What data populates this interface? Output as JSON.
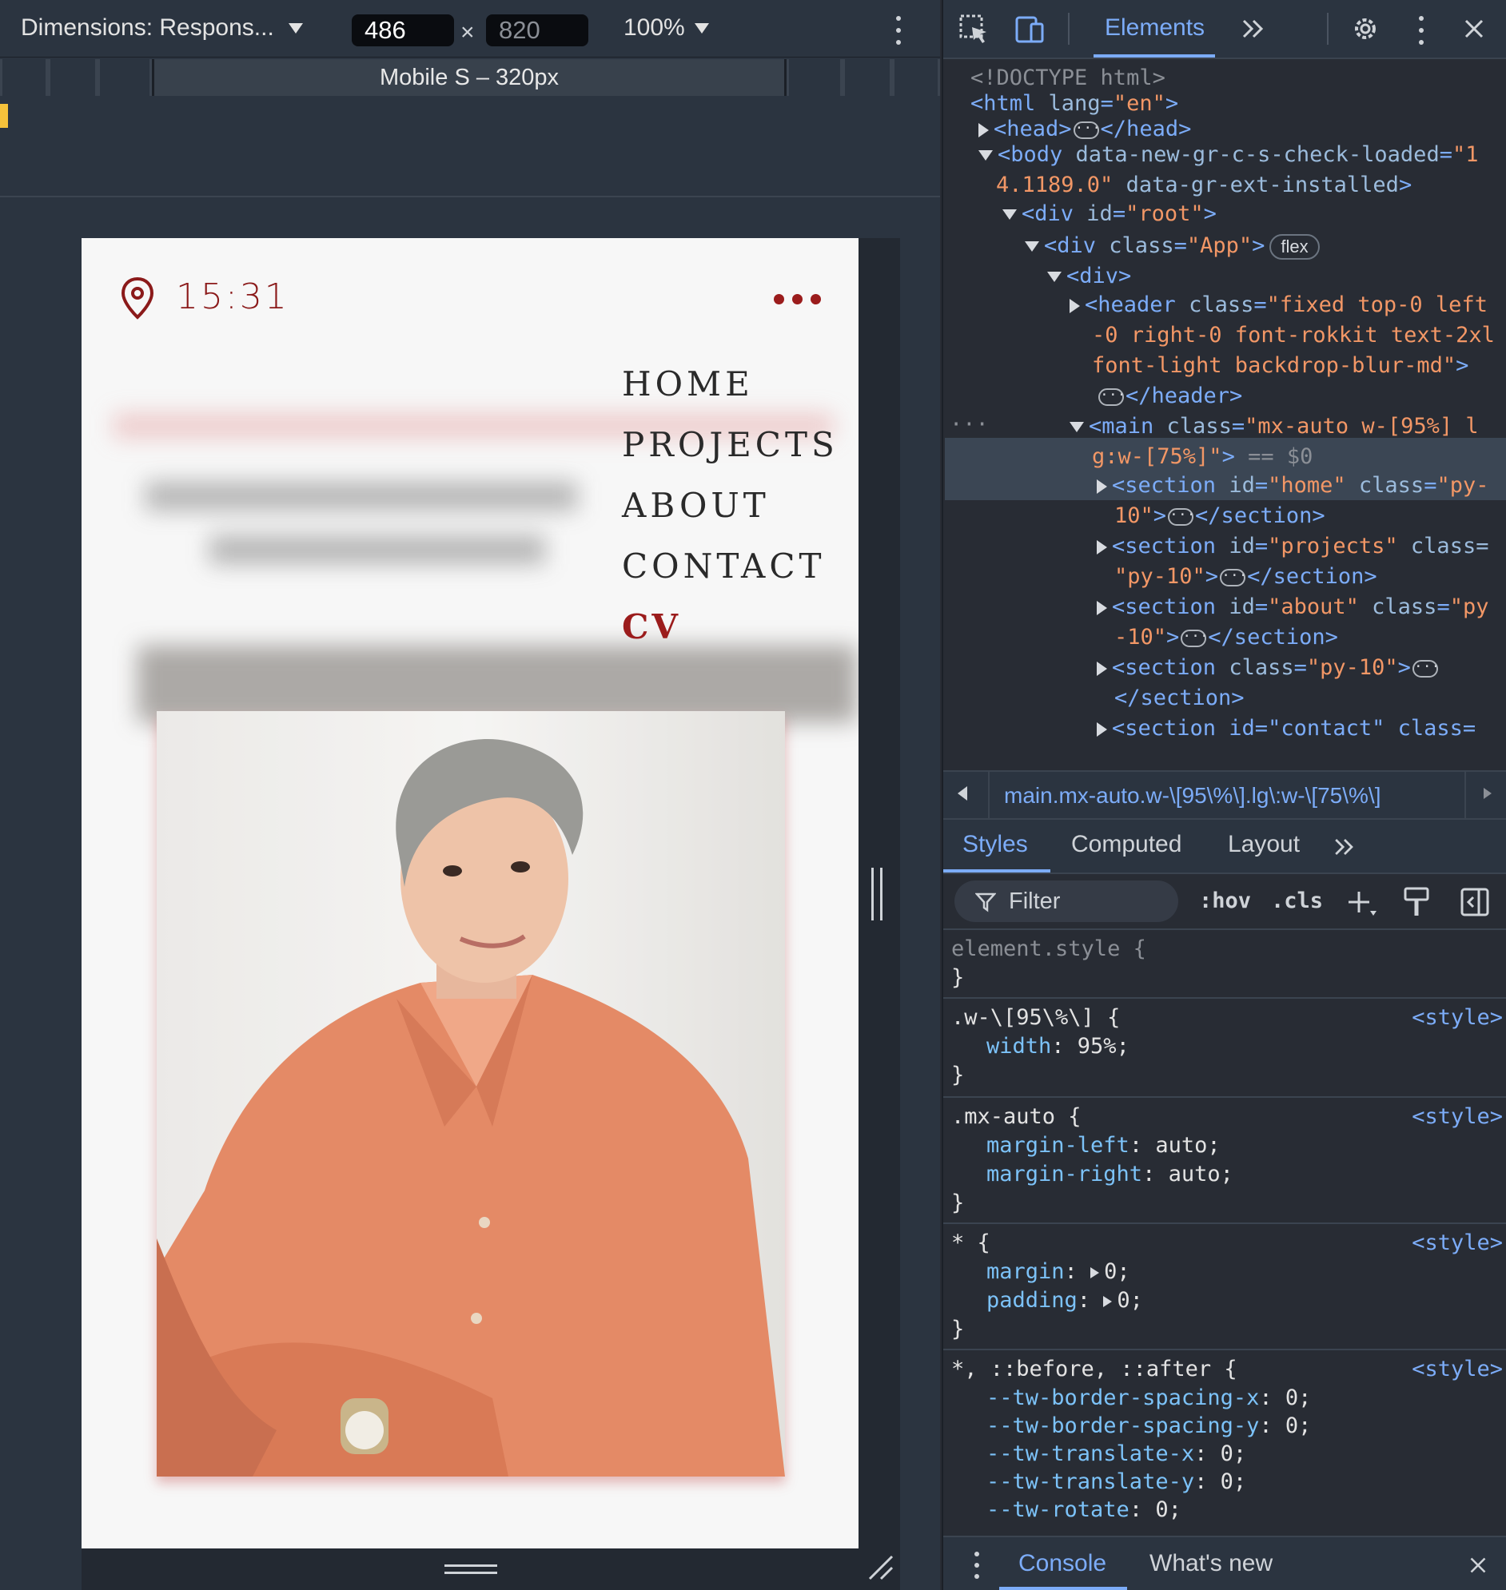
{
  "device_toolbar": {
    "dimensions_label": "Dimensions: Respons...",
    "width": "486",
    "times": "×",
    "height": "820",
    "zoom": "100%",
    "media_query_label": "Mobile S – 320px"
  },
  "site": {
    "time": "15:31",
    "nav": [
      "HOME",
      "PROJECTS",
      "ABOUT",
      "CONTACT",
      "CV"
    ],
    "accent_color": "#9b1c1c"
  },
  "devtools": {
    "tabs": {
      "elements": "Elements"
    },
    "dom": {
      "l1": "<!DOCTYPE html>",
      "html_open": "<html",
      "html_attr": "lang",
      "html_val": "\"en\"",
      "head": "<head>",
      "head_close": "</head>",
      "body_open": "<body",
      "body_attr1": "data-new-gr-c-s-check-loaded",
      "body_val1a": "\"1",
      "body_val1b": "4.1189.0\"",
      "body_attr2": "data-gr-ext-installed",
      "div_root_open": "<div",
      "div_root_attr": "id",
      "div_root_val": "\"root\"",
      "div_app_open": "<div",
      "div_app_attr": "class",
      "div_app_val": "\"App\"",
      "flex_badge": "flex",
      "div_plain": "<div>",
      "header_open": "<header",
      "header_attr": "class",
      "header_val1": "\"fixed top-0 left",
      "header_val2": "-0 right-0 font-rokkit text-2xl",
      "header_val3": "font-light backdrop-blur-md\"",
      "header_close": "</header>",
      "main_open": "<main",
      "main_attr": "class",
      "main_val1": "\"mx-auto w-[95%] l",
      "main_val2": "g:w-[75%]\"",
      "main_eq": "== $0",
      "s1_open": "<section",
      "s1_attr1": "id",
      "s1_val1": "\"home\"",
      "s1_attr2": "class",
      "s1_val2a": "\"py-",
      "s1_val2b": "10\"",
      "section_close": "</section>",
      "s2_open": "<section",
      "s2_val1": "\"projects\"",
      "s2_attr2": "class=",
      "s2_val2": "\"py-10\"",
      "s3_open": "<section",
      "s3_val1": "\"about\"",
      "s3_val2a": "\"py",
      "s3_val2b": "-10\"",
      "s4_open": "<section",
      "s4_val": "\"py-10\"",
      "s5_text": "<section id=\"contact\" class="
    },
    "breadcrumb": "main.mx-auto.w-\\[95\\%\\].lg\\:w-\\[75\\%\\]",
    "styles_tabs": [
      "Styles",
      "Computed",
      "Layout"
    ],
    "filter_placeholder": "Filter",
    "hov": ":hov",
    "cls": ".cls",
    "rules": {
      "r0_sel": "element.style {",
      "r0_close": "}",
      "r1_sel": ".w-\\[95\\%\\] {",
      "r1_p1": "width",
      "r1_v1": "95%;",
      "r1_close": "}",
      "r1_src": "<style>",
      "r2_sel": ".mx-auto {",
      "r2_p1": "margin-left",
      "r2_v1": "auto;",
      "r2_p2": "margin-right",
      "r2_v2": "auto;",
      "r2_close": "}",
      "r2_src": "<style>",
      "r3_sel": "* {",
      "r3_p1": "margin",
      "r3_v1": "0;",
      "r3_p2": "padding",
      "r3_v2": "0;",
      "r3_close": "}",
      "r3_src": "<style>",
      "r4_sel": "*, ::before, ::after {",
      "r4_src": "<style>",
      "r4_props": [
        {
          "p": "--tw-border-spacing-x",
          "v": "0;"
        },
        {
          "p": "--tw-border-spacing-y",
          "v": "0;"
        },
        {
          "p": "--tw-translate-x",
          "v": "0;"
        },
        {
          "p": "--tw-translate-y",
          "v": "0;"
        },
        {
          "p": "--tw-rotate",
          "v": "0;"
        }
      ]
    },
    "console_tab": "Console",
    "whats_new_tab": "What's new"
  }
}
